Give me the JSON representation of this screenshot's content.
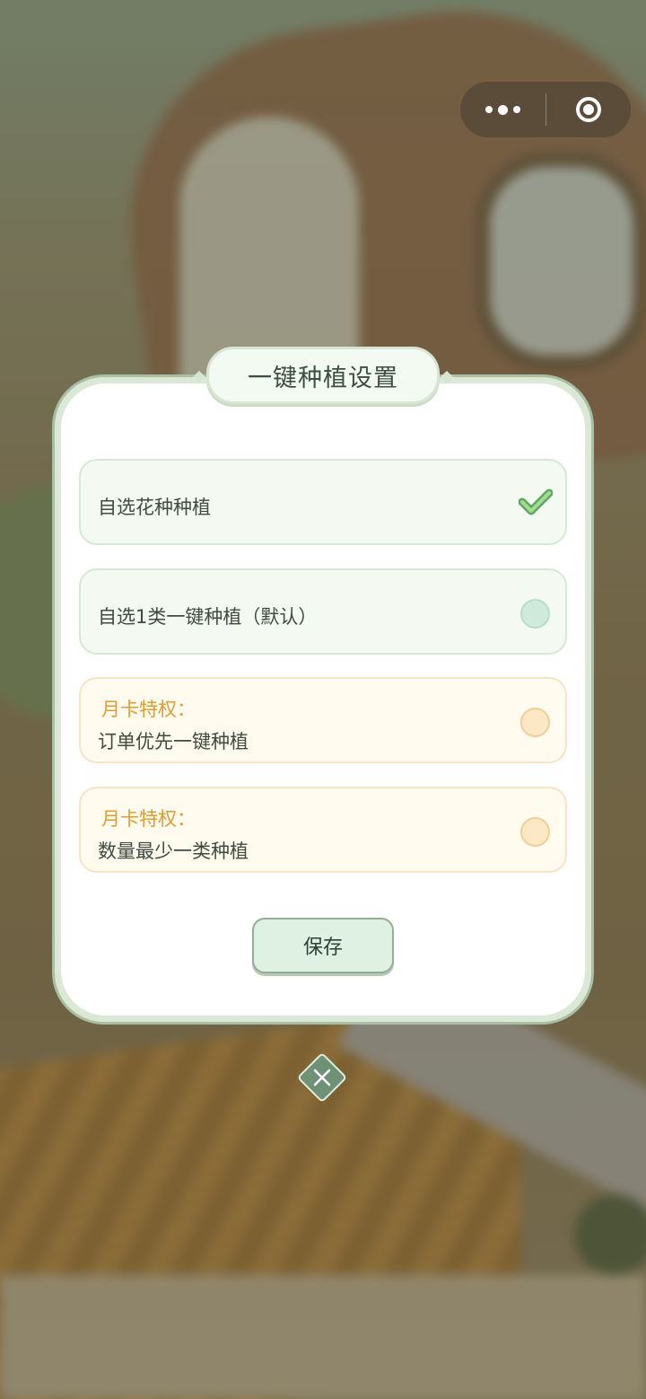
{
  "dialog": {
    "title": "一键种植设置",
    "options": [
      {
        "label": "自选花种种植",
        "state": "selected"
      },
      {
        "label": "自选1类一键种植（默认）",
        "state": "unselected"
      },
      {
        "tag": "月卡特权：",
        "label": "订单优先一键种植",
        "state": "unselected"
      },
      {
        "tag": "月卡特权：",
        "label": "数量最少一类种植",
        "state": "unselected"
      }
    ],
    "save_label": "保存"
  },
  "capsule": {
    "more_icon": "more-dots-icon",
    "close_icon": "target-circle-icon"
  },
  "colors": {
    "accent_green": "#7cc47f",
    "gold_tag": "#e59a2c"
  }
}
